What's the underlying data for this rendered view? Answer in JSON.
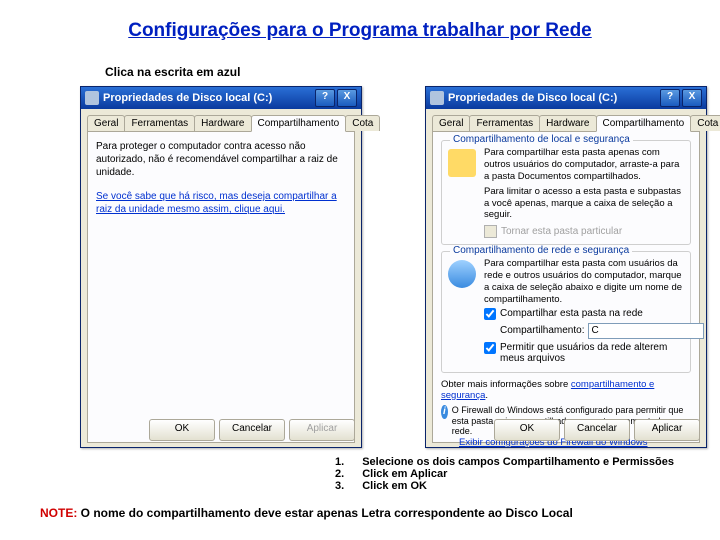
{
  "title": "Configurações para o Programa trabalhar por Rede",
  "subtitle": "Clica na escrita em azul",
  "dialogTitle": "Propriedades de Disco local (C:)",
  "tabs": {
    "geral": "Geral",
    "ferramentas": "Ferramentas",
    "hardware": "Hardware",
    "compart": "Compartilhamento",
    "cota": "Cota"
  },
  "leftPanel": {
    "text1": "Para proteger o computador contra acesso não autorizado, não é recomendável compartilhar a raiz de unidade.",
    "linkText": "Se você sabe que há risco, mas deseja compartilhar a raiz da unidade mesmo assim, clique aqui."
  },
  "rightPanel": {
    "group1Title": "Compartilhamento de local e segurança",
    "g1text": "Para compartilhar esta pasta apenas com outros usuários do computador, arraste-a para a pasta Documentos compartilhados.",
    "g1text2": "Para limitar o acesso a esta pasta e subpastas a você apenas, marque a caixa de seleção a seguir.",
    "g1chk": "Tornar esta pasta particular",
    "group2Title": "Compartilhamento de rede e segurança",
    "g2text": "Para compartilhar esta pasta com usuários da rede e outros usuários do computador, marque a caixa de seleção abaixo e digite um nome de compartilhamento.",
    "chk1": "Compartilhar esta pasta na rede",
    "shareLabel": "Compartilhamento:",
    "shareValue": "C",
    "chk2": "Permitir que usuários da rede alterem meus arquivos",
    "learnMore": "Obter mais informações sobre",
    "learnLink": "compartilhamento e segurança",
    "firewall": "O Firewall do Windows está configurado para permitir que esta pasta seja compartilhada com outros computadores na rede.",
    "firewallLink": "Exibir configurações do Firewall do Windows"
  },
  "buttons": {
    "ok": "OK",
    "cancel": "Cancelar",
    "apply": "Aplicar"
  },
  "steps": {
    "n1": "1.",
    "n2": "2.",
    "n3": "3.",
    "s1": "Selecione os dois campos Compartilhamento e Permissões",
    "s2": "Click em Aplicar",
    "s3": "Click em OK"
  },
  "note": {
    "prefix": "NOTE:",
    "text": " O nome do compartilhamento deve estar apenas Letra correspondente ao Disco Local"
  },
  "titleButtons": {
    "help": "?",
    "close": "X"
  }
}
